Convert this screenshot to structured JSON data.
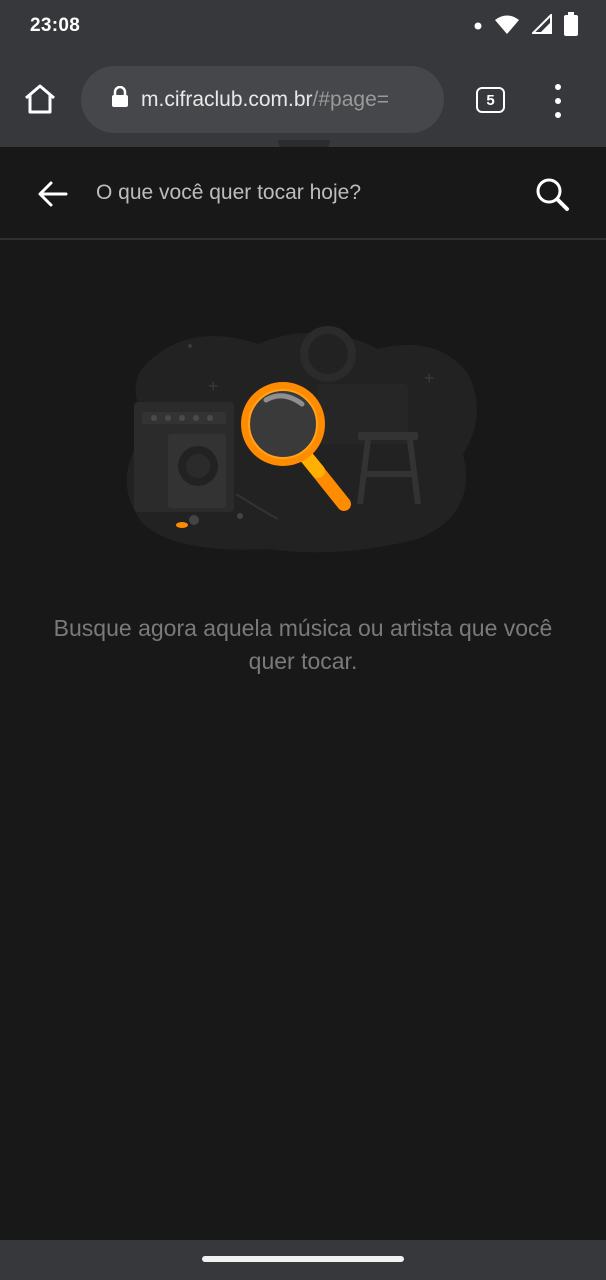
{
  "status_bar": {
    "time": "23:08",
    "icons": [
      "notification-dot-icon",
      "wifi-icon",
      "signal-icon",
      "battery-icon"
    ]
  },
  "browser": {
    "url_domain": "m.cifraclub.com.br",
    "url_path": "/#page=",
    "tab_count": "5",
    "icons": [
      "home-icon",
      "lock-icon",
      "more-vert-icon"
    ]
  },
  "search": {
    "placeholder": "O que você quer tocar hoje?",
    "icons": [
      "back-arrow-icon",
      "search-icon"
    ]
  },
  "empty_state": {
    "message": "Busque agora aquela música ou artista que você quer tocar."
  },
  "colors": {
    "accent": "#ff8c00",
    "background": "#181818",
    "chrome": "#36383b"
  }
}
